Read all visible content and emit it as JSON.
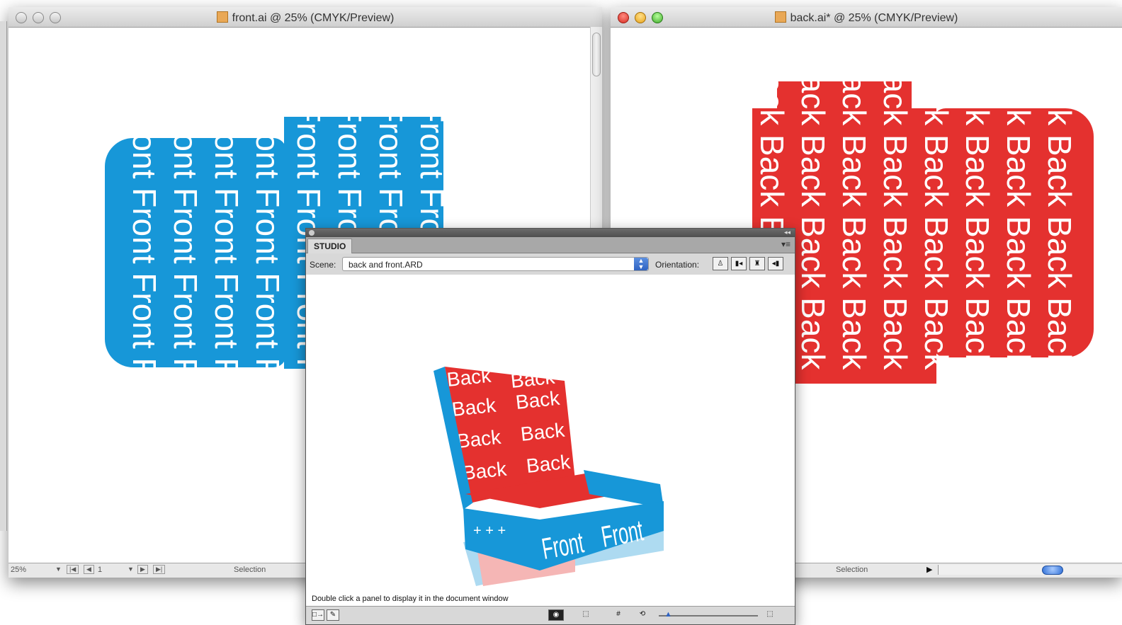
{
  "left_window": {
    "title": "front.ai @ 25% (CMYK/Preview)",
    "zoom": "25%",
    "page_number": "1",
    "status_text": "Selection",
    "artwork_word": "Front",
    "artwork_color": "#1797d8"
  },
  "right_window": {
    "title": "back.ai* @ 25% (CMYK/Preview)",
    "status_text": "Selection",
    "artwork_word": "Back",
    "artwork_color": "#e4312f"
  },
  "studio": {
    "tab_label": "STUDIO",
    "scene_label": "Scene:",
    "scene_value": "back and front.ARD",
    "orientation_label": "Orientation:",
    "hint_text": "Double click a panel to display it in the document window",
    "orientation_icons": [
      "person-icon",
      "person-side-icon",
      "trophy-icon",
      "person-back-icon"
    ],
    "bottom_icons": [
      "add-panel-icon",
      "edit-panel-icon",
      "camera-icon",
      "cube-icon",
      "grid-icon",
      "rotate-icon",
      "zoom-slider",
      "box-view-icon"
    ]
  }
}
